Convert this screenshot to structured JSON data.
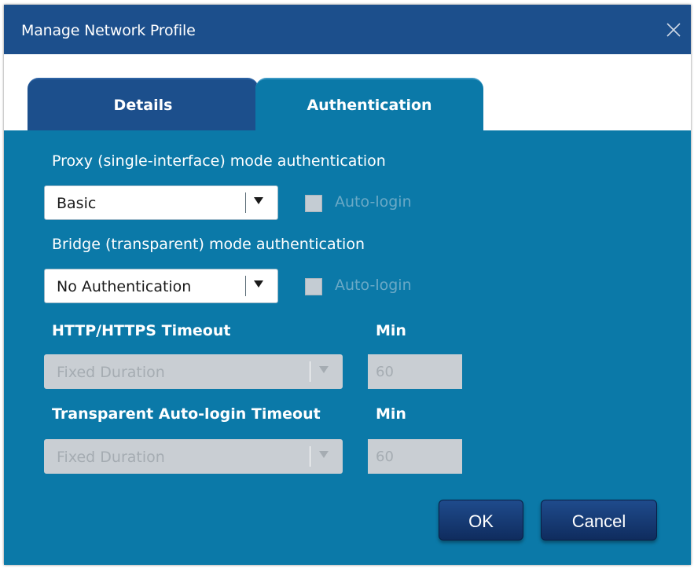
{
  "window": {
    "title": "Manage Network Profile",
    "close_icon": "close-icon"
  },
  "tabs": [
    {
      "label": "Details",
      "active": false
    },
    {
      "label": "Authentication",
      "active": true
    }
  ],
  "proxy": {
    "label": "Proxy (single-interface) mode authentication",
    "selected": "Basic",
    "autologin_label": "Auto-login",
    "autologin_checked": false
  },
  "bridge": {
    "label": "Bridge (transparent) mode authentication",
    "selected": "No Authentication",
    "autologin_label": "Auto-login",
    "autologin_checked": false
  },
  "http_timeout": {
    "label": "HTTP/HTTPS Timeout",
    "unit_label": "Min",
    "selected": "Fixed Duration",
    "value": "60",
    "enabled": false
  },
  "transparent_timeout": {
    "label": "Transparent Auto-login Timeout",
    "unit_label": "Min",
    "selected": "Fixed Duration",
    "value": "60",
    "enabled": false
  },
  "buttons": {
    "ok": "OK",
    "cancel": "Cancel"
  },
  "colors": {
    "titlebar": "#1c4f8c",
    "panel": "#0b79a8",
    "button": "#15386f"
  }
}
